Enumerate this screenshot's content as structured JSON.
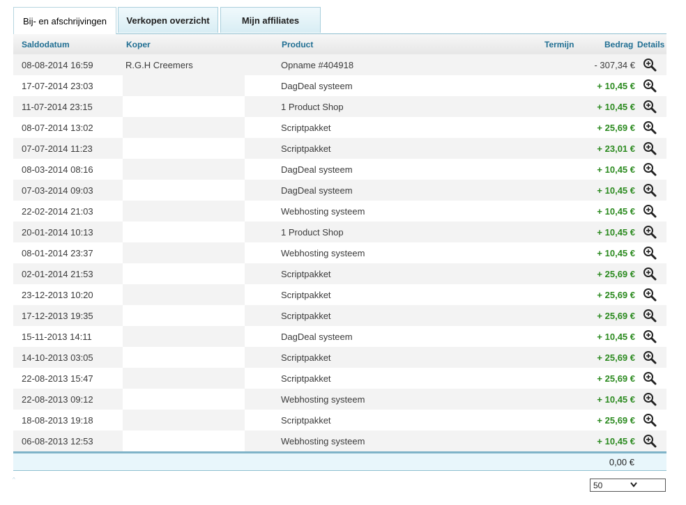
{
  "tabs": [
    {
      "label": "Bij- en afschrijvingen",
      "active": true
    },
    {
      "label": "Verkopen overzicht",
      "active": false
    },
    {
      "label": "Mijn affiliates",
      "active": false
    }
  ],
  "columns": {
    "saldodatum": "Saldodatum",
    "koper": "Koper",
    "product": "Product",
    "termijn": "Termijn",
    "bedrag": "Bedrag",
    "details": "Details"
  },
  "rows": [
    {
      "date": "08-08-2014 16:59",
      "koper": "R.G.H Creemers",
      "product": "Opname #404918",
      "amount": "- 307,34 €",
      "negative": true
    },
    {
      "date": "17-07-2014 23:03",
      "koper": "",
      "product": "DagDeal systeem",
      "amount": "+ 10,45 €",
      "negative": false
    },
    {
      "date": "11-07-2014 23:15",
      "koper": "",
      "product": "1 Product Shop",
      "amount": "+ 10,45 €",
      "negative": false
    },
    {
      "date": "08-07-2014 13:02",
      "koper": "",
      "product": "Scriptpakket",
      "amount": "+ 25,69 €",
      "negative": false
    },
    {
      "date": "07-07-2014 11:23",
      "koper": "",
      "product": "Scriptpakket",
      "amount": "+ 23,01 €",
      "negative": false
    },
    {
      "date": "08-03-2014 08:16",
      "koper": "",
      "product": "DagDeal systeem",
      "amount": "+ 10,45 €",
      "negative": false
    },
    {
      "date": "07-03-2014 09:03",
      "koper": "",
      "product": "DagDeal systeem",
      "amount": "+ 10,45 €",
      "negative": false
    },
    {
      "date": "22-02-2014 21:03",
      "koper": "",
      "product": "Webhosting systeem",
      "amount": "+ 10,45 €",
      "negative": false
    },
    {
      "date": "20-01-2014 10:13",
      "koper": "",
      "product": "1 Product Shop",
      "amount": "+ 10,45 €",
      "negative": false
    },
    {
      "date": "08-01-2014 23:37",
      "koper": "",
      "product": "Webhosting systeem",
      "amount": "+ 10,45 €",
      "negative": false
    },
    {
      "date": "02-01-2014 21:53",
      "koper": "",
      "product": "Scriptpakket",
      "amount": "+ 25,69 €",
      "negative": false
    },
    {
      "date": "23-12-2013 10:20",
      "koper": "",
      "product": "Scriptpakket",
      "amount": "+ 25,69 €",
      "negative": false
    },
    {
      "date": "17-12-2013 19:35",
      "koper": "",
      "product": "Scriptpakket",
      "amount": "+ 25,69 €",
      "negative": false
    },
    {
      "date": "15-11-2013 14:11",
      "koper": "",
      "product": "DagDeal systeem",
      "amount": "+ 10,45 €",
      "negative": false
    },
    {
      "date": "14-10-2013 03:05",
      "koper": "",
      "product": "Scriptpakket",
      "amount": "+ 25,69 €",
      "negative": false
    },
    {
      "date": "22-08-2013 15:47",
      "koper": "",
      "product": "Scriptpakket",
      "amount": "+ 25,69 €",
      "negative": false
    },
    {
      "date": "22-08-2013 09:12",
      "koper": "",
      "product": "Webhosting systeem",
      "amount": "+ 10,45 €",
      "negative": false
    },
    {
      "date": "18-08-2013 19:18",
      "koper": "",
      "product": "Scriptpakket",
      "amount": "+ 25,69 €",
      "negative": false
    },
    {
      "date": "06-08-2013 12:53",
      "koper": "",
      "product": "Webhosting systeem",
      "amount": "+ 10,45 €",
      "negative": false
    }
  ],
  "details_icon": "magnifier-plus-icon",
  "footer": {
    "total": "0,00 €"
  },
  "pager": {
    "page_size": "50"
  },
  "colors": {
    "positive": "#2b8a1f",
    "header_text": "#1f6e92",
    "accent_line": "#7fb3c8"
  }
}
